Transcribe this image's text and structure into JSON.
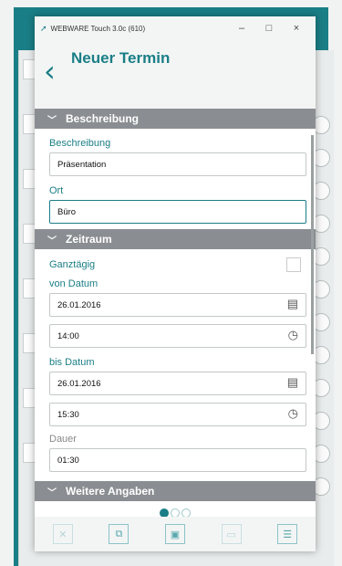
{
  "window": {
    "title": "WEBWARE Touch 3.0c (610)",
    "minimize": "–",
    "maximize": "□",
    "close": "×"
  },
  "header": {
    "back_icon": "back-chevron-icon",
    "title": "Neuer Termin"
  },
  "sections": {
    "beschreibung": "Beschreibung",
    "zeitraum": "Zeitraum",
    "weitere": "Weitere Angaben"
  },
  "form": {
    "beschreibung_label": "Beschreibung",
    "beschreibung_value": "Präsentation",
    "ort_label": "Ort",
    "ort_value": "Büro",
    "ganztaegig_label": "Ganztägig",
    "ganztaegig_checked": false,
    "von_label": "von Datum",
    "von_date": "26.01.2016",
    "von_time": "14:00",
    "bis_label": "bis Datum",
    "bis_date": "26.01.2016",
    "bis_time": "15:30",
    "dauer_label": "Dauer",
    "dauer_value": "01:30"
  },
  "pager": {
    "pages": 3,
    "active": 1
  },
  "toolbar": {
    "buttons": [
      "delete-icon",
      "copy-icon",
      "save-icon",
      "window-icon",
      "list-icon"
    ]
  },
  "colors": {
    "accent": "#1a7e86",
    "section_bar": "#8a8d91"
  }
}
